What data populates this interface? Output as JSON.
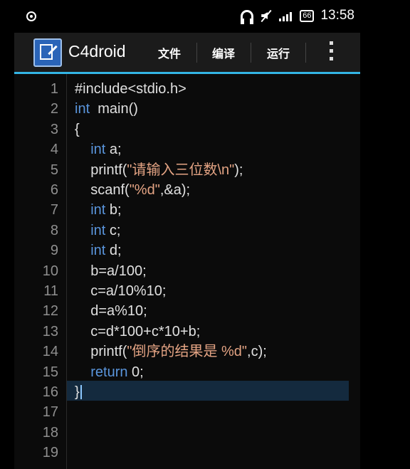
{
  "status_bar": {
    "time": "13:58",
    "battery": "66",
    "icons": [
      "record-icon",
      "headset-icon",
      "mute-icon",
      "signal-icon",
      "battery-icon"
    ]
  },
  "app_bar": {
    "title": "C4droid",
    "menu": [
      "文件",
      "编译",
      "运行"
    ],
    "overflow_icon": "more-vert-icon"
  },
  "editor": {
    "line_numbers": [
      "1",
      "2",
      "3",
      "4",
      "5",
      "6",
      "7",
      "8",
      "9",
      "10",
      "11",
      "12",
      "13",
      "14",
      "15",
      "16",
      "17",
      "18",
      "19"
    ],
    "lines": [
      [
        {
          "t": "tx",
          "v": "#include<stdio.h>"
        }
      ],
      [
        {
          "t": "kw",
          "v": "int"
        },
        {
          "t": "tx",
          "v": "  main()"
        }
      ],
      [
        {
          "t": "tx",
          "v": "{"
        }
      ],
      [
        {
          "t": "kw",
          "v": "    int"
        },
        {
          "t": "tx",
          "v": " a;"
        }
      ],
      [
        {
          "t": "tx",
          "v": "    printf("
        },
        {
          "t": "str",
          "v": "\"请输入三位数\\n\""
        },
        {
          "t": "tx",
          "v": ");"
        }
      ],
      [
        {
          "t": "tx",
          "v": "    scanf("
        },
        {
          "t": "str",
          "v": "\"%d\""
        },
        {
          "t": "tx",
          "v": ",&a);"
        }
      ],
      [
        {
          "t": "kw",
          "v": "    int"
        },
        {
          "t": "tx",
          "v": " b;"
        }
      ],
      [
        {
          "t": "kw",
          "v": "    int"
        },
        {
          "t": "tx",
          "v": " c;"
        }
      ],
      [
        {
          "t": "kw",
          "v": "    int"
        },
        {
          "t": "tx",
          "v": " d;"
        }
      ],
      [
        {
          "t": "tx",
          "v": "    b=a/100;"
        }
      ],
      [
        {
          "t": "tx",
          "v": "    c=a/10%10;"
        }
      ],
      [
        {
          "t": "tx",
          "v": "    d=a%10;"
        }
      ],
      [
        {
          "t": "tx",
          "v": "    c=d*100+c*10+b;"
        }
      ],
      [
        {
          "t": "tx",
          "v": "    printf("
        },
        {
          "t": "str",
          "v": "\"倒序的结果是 %d\""
        },
        {
          "t": "tx",
          "v": ",c);"
        }
      ],
      [
        {
          "t": "kw",
          "v": "    return"
        },
        {
          "t": "tx",
          "v": " 0;"
        }
      ],
      [
        {
          "t": "tx",
          "v": "}"
        }
      ],
      [],
      [],
      []
    ]
  }
}
